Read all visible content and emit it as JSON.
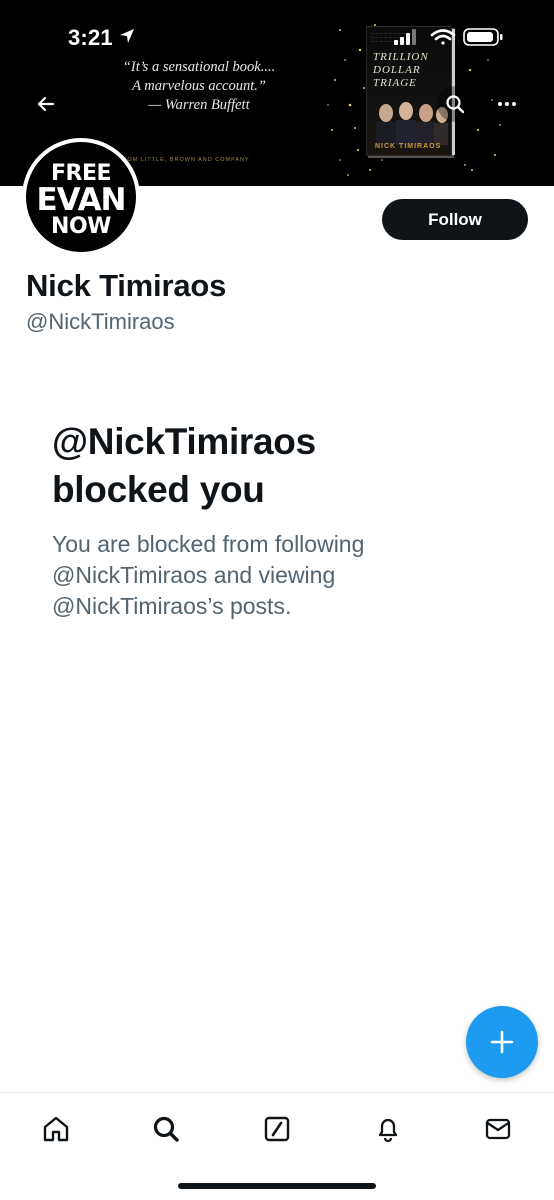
{
  "status_bar": {
    "time": "3:21"
  },
  "banner": {
    "quote_lines": [
      "“It’s a sensational book....",
      "A marvelous account.”",
      "— Warren Buffett"
    ],
    "publisher": "FROM LITTLE, BROWN AND COMPANY",
    "book_title_lines": [
      "TRILLION",
      "DOLLAR",
      "TRIAGE"
    ],
    "book_author": "NICK TIMIRAOS"
  },
  "profile": {
    "avatar_text": [
      "FREE",
      "EVAN",
      "NOW"
    ],
    "follow_label": "Follow",
    "display_name": "Nick Timiraos",
    "handle": "@NickTimiraos"
  },
  "blocked": {
    "title_line1": "@NickTimiraos",
    "title_line2": "blocked you",
    "message": "You are blocked from following @NickTimiraos and viewing @NickTimiraos’s posts."
  },
  "icons": {
    "back": "back-arrow-icon",
    "search": "search-icon",
    "more": "more-icon",
    "compose": "compose-plus-icon",
    "tabs": [
      "home-icon",
      "search-icon",
      "grok-icon",
      "notifications-icon",
      "messages-icon"
    ]
  },
  "colors": {
    "accent": "#1d9bf0",
    "text": "#0f1419",
    "secondary_text": "#536471"
  }
}
